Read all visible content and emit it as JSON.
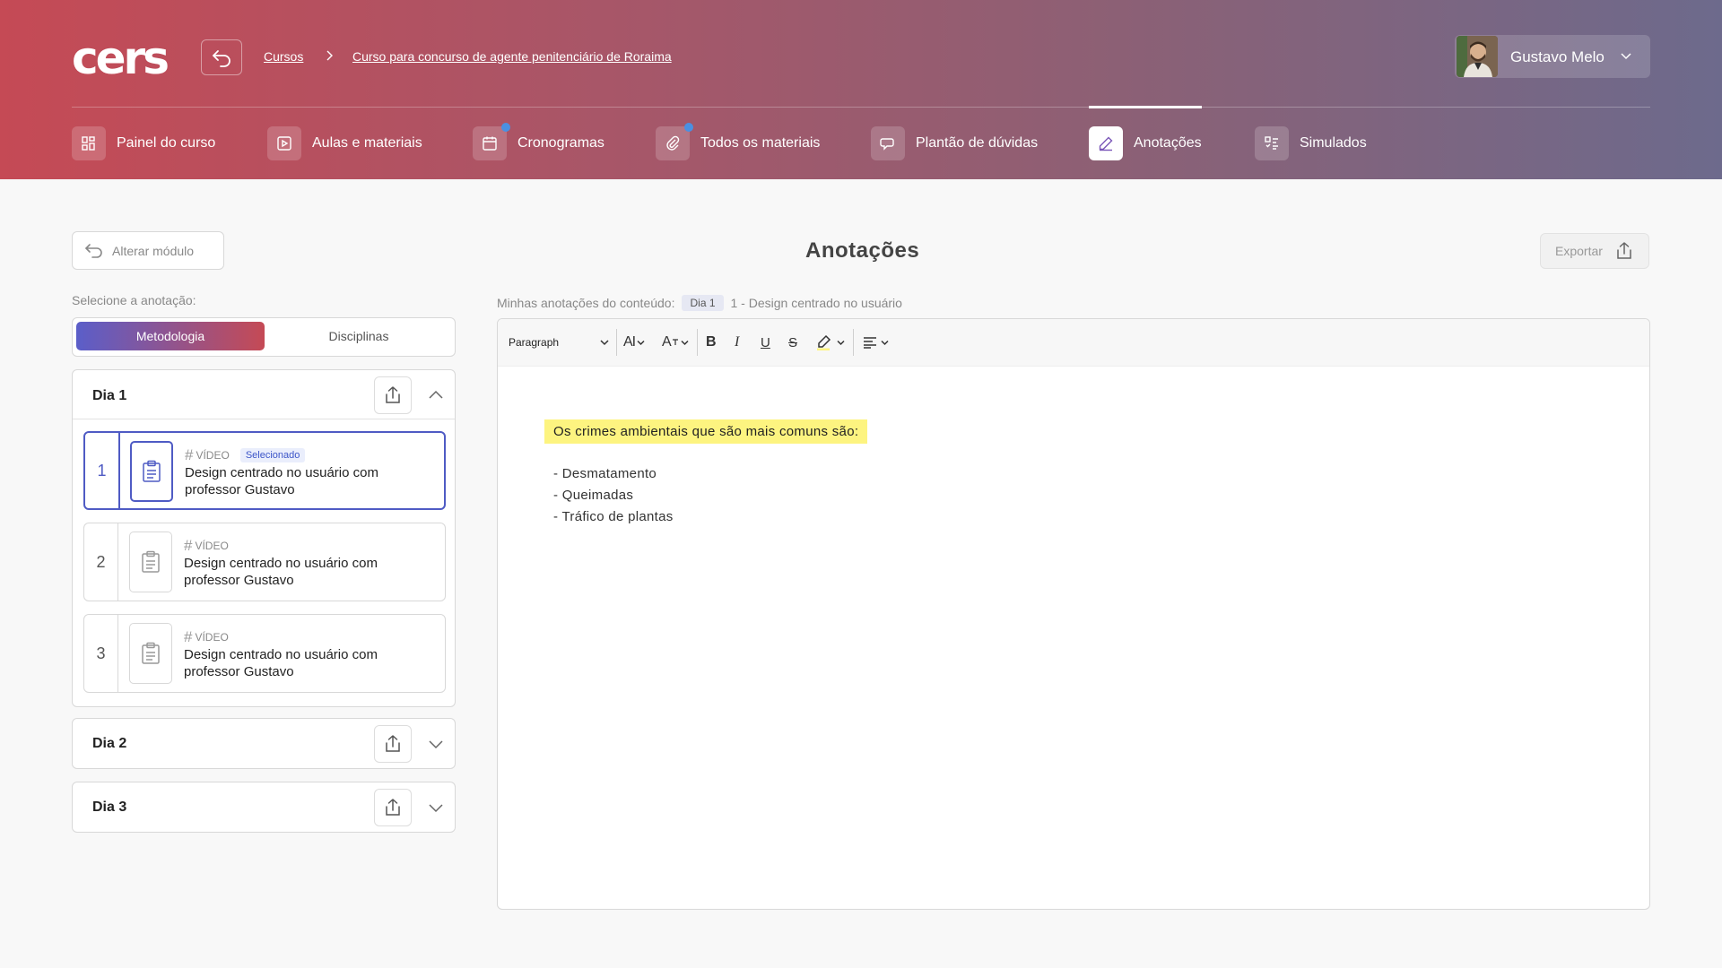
{
  "brand": {
    "logo_text": "cers"
  },
  "breadcrumb": {
    "items": [
      "Cursos",
      "Curso para concurso de agente penitenciário de Roraima"
    ]
  },
  "user": {
    "name": "Gustavo Melo"
  },
  "nav": {
    "tabs": [
      {
        "label": "Painel do curso",
        "icon": "grid-icon"
      },
      {
        "label": "Aulas e materiais",
        "icon": "play-icon"
      },
      {
        "label": "Cronogramas",
        "icon": "calendar-icon",
        "notification": true
      },
      {
        "label": "Todos os materiais",
        "icon": "paperclip-icon",
        "notification": true
      },
      {
        "label": "Plantão de dúvidas",
        "icon": "chat-icon"
      },
      {
        "label": "Anotações",
        "icon": "pencil-icon",
        "active": true
      },
      {
        "label": "Simulados",
        "icon": "checklist-icon"
      }
    ]
  },
  "sidebar": {
    "back_label": "Alterar módulo",
    "select_label": "Selecione a anotação:",
    "segments": [
      "Metodologia",
      "Disciplinas"
    ],
    "active_segment": "Metodologia",
    "days": [
      {
        "title": "Dia 1",
        "expanded": true,
        "lessons": [
          {
            "number": "1",
            "type": "VÍDEO",
            "title": "Design centrado no usuário com professor Gustavo",
            "selected": true,
            "badge": "Selecionado"
          },
          {
            "number": "2",
            "type": "VÍDEO",
            "title": "Design centrado no usuário com professor Gustavo"
          },
          {
            "number": "3",
            "type": "VÍDEO",
            "title": "Design centrado no usuário com professor Gustavo"
          }
        ]
      },
      {
        "title": "Dia 2",
        "expanded": false
      },
      {
        "title": "Dia 3",
        "expanded": false
      }
    ]
  },
  "main": {
    "title": "Anotações",
    "export_label": "Exportar",
    "content_label": "Minhas anotações do conteúdo:",
    "content_badge": "Dia 1",
    "content_name": "1 - Design centrado no usuário",
    "toolbar": {
      "paragraph": "Paragraph",
      "font_size": "AI",
      "font_style": "A",
      "bold": "B",
      "italic": "I",
      "underline": "U",
      "strike": "S"
    },
    "highlight_text": "Os crimes ambientais que são mais comuns são:",
    "lines": [
      "- Desmatamento",
      "- Queimadas",
      "- Tráfico de plantas"
    ],
    "highlight_color": "#fdf480"
  },
  "colors": {
    "accent": "#4f5bc4",
    "header_start": "#c54a55",
    "header_end": "#6d6a8c"
  }
}
